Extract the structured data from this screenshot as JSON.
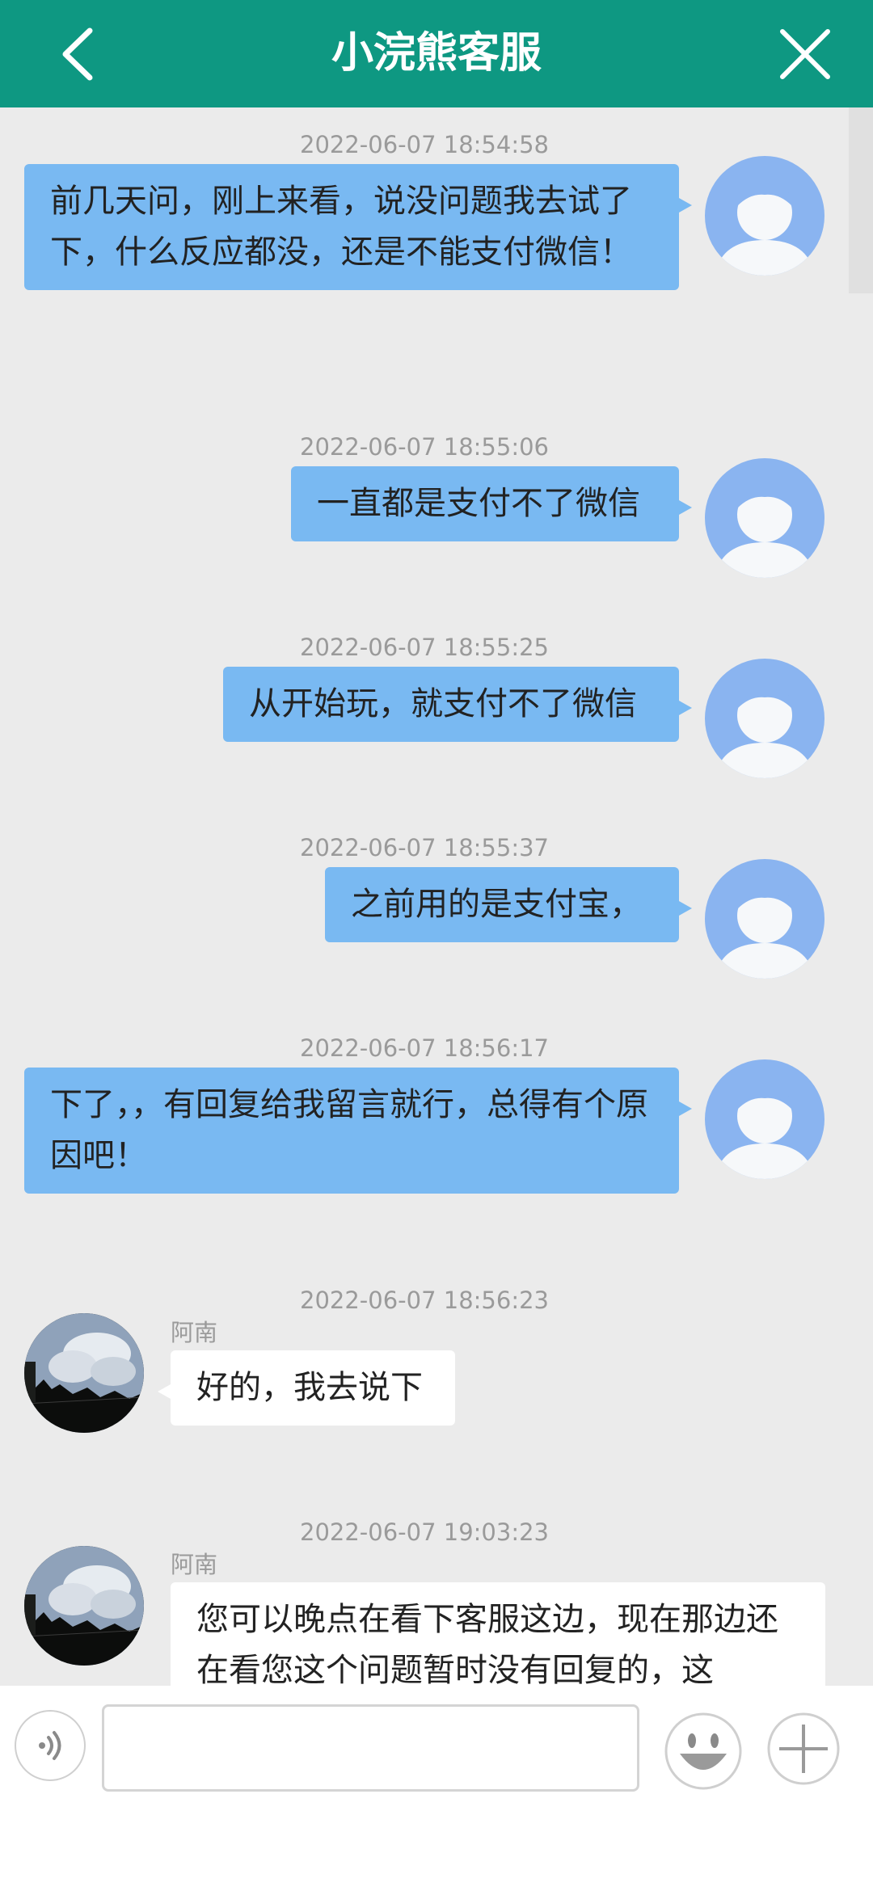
{
  "header": {
    "title": "小浣熊客服",
    "back_icon": "chevron-left-icon",
    "close_icon": "close-icon"
  },
  "messages": [
    {
      "time": "2022-06-07 18:54:58",
      "sender": "user",
      "text": "前几天问，刚上来看，说没问题我去试了下，什么反应都没，还是不能支付微信！"
    },
    {
      "time": "2022-06-07 18:55:06",
      "sender": "user",
      "text": "一直都是支付不了微信"
    },
    {
      "time": "2022-06-07 18:55:25",
      "sender": "user",
      "text": "从开始玩，就支付不了微信"
    },
    {
      "time": "2022-06-07 18:55:37",
      "sender": "user",
      "text": "之前用的是支付宝，"
    },
    {
      "time": "2022-06-07 18:56:17",
      "sender": "user",
      "text": "下了，，有回复给我留言就行，总得有个原因吧！"
    },
    {
      "time": "2022-06-07 18:56:23",
      "sender": "agent",
      "name": "阿南",
      "text": "好的，我去说下"
    },
    {
      "time": "2022-06-07 19:03:23",
      "sender": "agent",
      "name": "阿南",
      "text": "您可以晚点在看下客服这边，现在那边还在看您这个问题暂时没有回复的，这"
    }
  ],
  "input": {
    "placeholder": "",
    "value": "",
    "voice_icon": "voice-icon",
    "emoji_icon": "emoji-icon",
    "plus_icon": "plus-icon"
  },
  "colors": {
    "header": "#0e9882",
    "user_bubble": "#79b9f2",
    "agent_bubble": "#ffffff",
    "chat_background": "#ebebeb"
  }
}
